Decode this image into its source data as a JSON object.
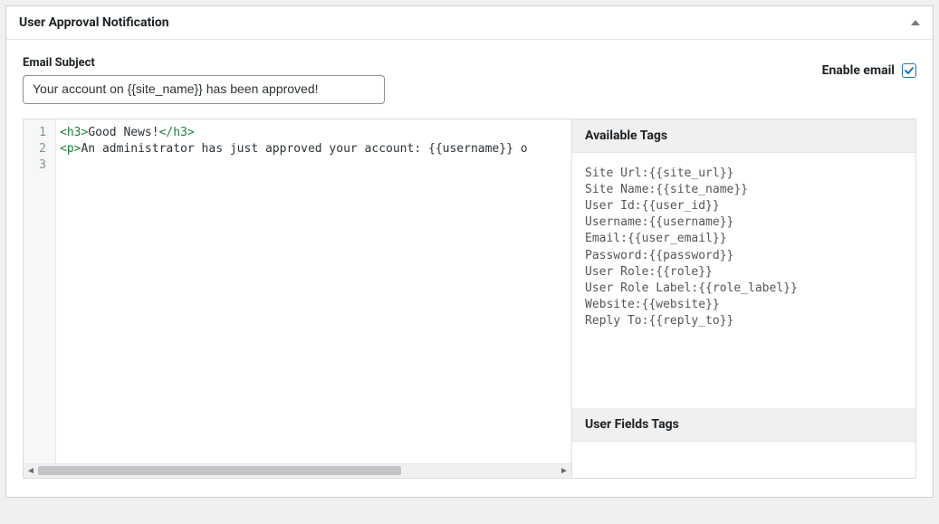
{
  "panel": {
    "title": "User Approval Notification"
  },
  "subject": {
    "label": "Email Subject",
    "value": "Your account on {{site_name}} has been approved!"
  },
  "enable": {
    "label": "Enable email",
    "checked": true
  },
  "editor": {
    "gutter": [
      "1",
      "2",
      "3"
    ],
    "line1_tag_open": "<h3>",
    "line1_text": "Good News!",
    "line1_tag_close": "</h3>",
    "line2_tag_open": "<p>",
    "line2_text": "An administrator has just approved your account: {{username}} o"
  },
  "tags": {
    "available_header": "Available Tags",
    "items": [
      "Site Url:{{site_url}}",
      "Site Name:{{site_name}}",
      "User Id:{{user_id}}",
      "Username:{{username}}",
      "Email:{{user_email}}",
      "Password:{{password}}",
      "User Role:{{role}}",
      "User Role Label:{{role_label}}",
      "Website:{{website}}",
      "Reply To:{{reply_to}}"
    ],
    "user_fields_header": "User Fields Tags"
  }
}
